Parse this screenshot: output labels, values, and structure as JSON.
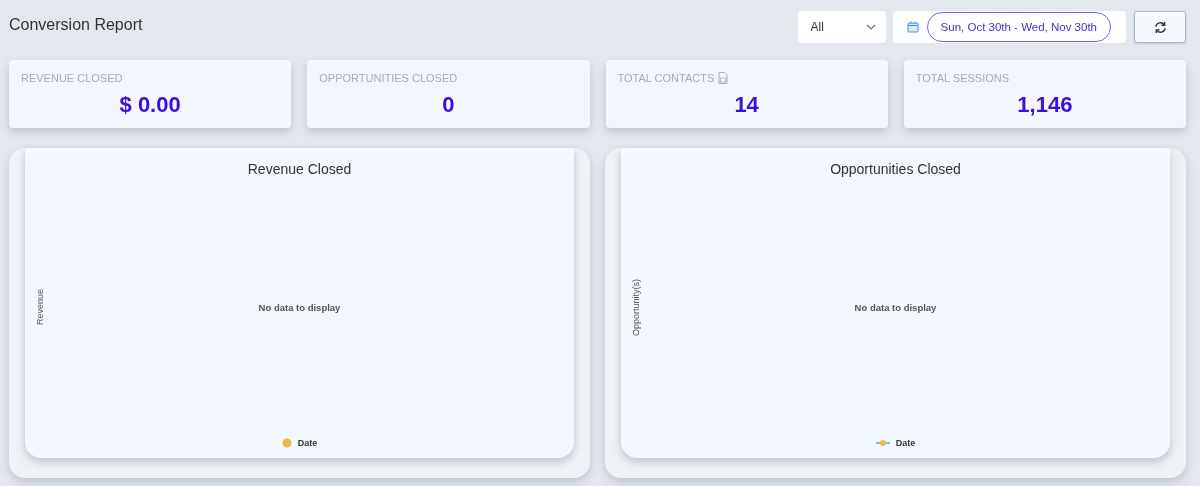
{
  "title": "Conversion Report",
  "filter": {
    "value": "All"
  },
  "date_range": {
    "value": "Sun, Oct 30th - Wed, Nov 30th"
  },
  "stats": [
    {
      "label": "REVENUE CLOSED",
      "value": "$ 0.00",
      "info_icon": false
    },
    {
      "label": "OPPORTUNITIES CLOSED",
      "value": "0",
      "info_icon": false
    },
    {
      "label": "TOTAL CONTACTS",
      "value": "14",
      "info_icon": true
    },
    {
      "label": "TOTAL SESSIONS",
      "value": "1,146",
      "info_icon": false
    }
  ],
  "charts": [
    {
      "title": "Revenue Closed",
      "ylabel": "Revenue",
      "message": "No data to display",
      "legend": {
        "label": "Date",
        "kind": "dot"
      }
    },
    {
      "title": "Opportunities Closed",
      "ylabel": "Opportunity(s)",
      "message": "No data to display",
      "legend": {
        "label": "Date",
        "kind": "line"
      }
    }
  ]
}
